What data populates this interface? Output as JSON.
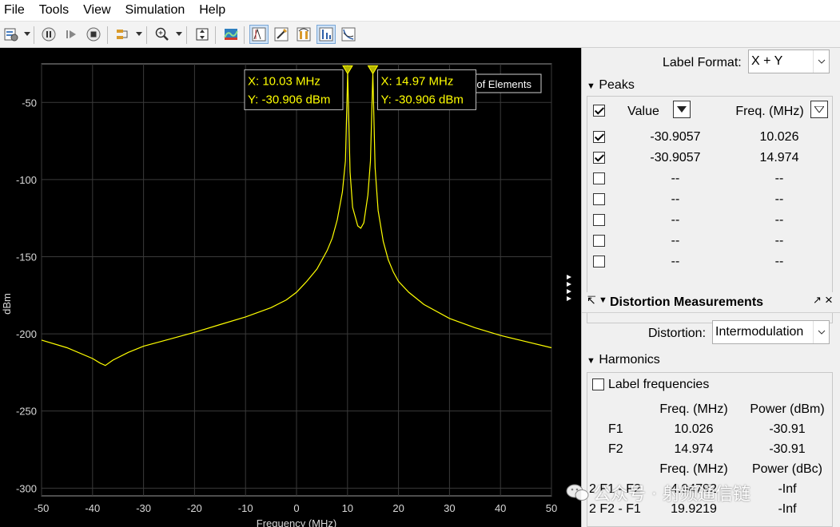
{
  "menu": [
    "File",
    "Tools",
    "View",
    "Simulation",
    "Help"
  ],
  "toolbar": {
    "buttons": [
      "settings-icon",
      "pause-icon",
      "step-forward-icon",
      "stop-icon",
      "highlight-icon",
      "zoom-in-icon",
      "scale-axes-icon",
      "spectrum-settings-icon",
      "data-cursors-icon",
      "peak-finder-icon",
      "channel-measurements-icon",
      "distortion-measurements-icon",
      "ccdf-icon"
    ]
  },
  "colors": {
    "plot_background": "#000000",
    "trace": "#ffff00",
    "axis_text": "#d9d9d9",
    "grid": "#3a3a3a"
  },
  "chart_data": {
    "type": "line",
    "title": "",
    "xlabel": "Frequency (MHz)",
    "ylabel": "dBm",
    "xlim": [
      -50,
      50
    ],
    "ylim": [
      -305,
      -25
    ],
    "xticks": [
      -50,
      -40,
      -30,
      -20,
      -10,
      0,
      10,
      20,
      30,
      40,
      50
    ],
    "yticks": [
      -50,
      -100,
      -150,
      -200,
      -250,
      -300
    ],
    "grid": true,
    "legend": {
      "placement": "top-right",
      "entries": [
        "Sum of Elements"
      ]
    },
    "series": [
      {
        "name": "Sum of Elements",
        "x": [
          -50,
          -45,
          -40,
          -38.5,
          -37.5,
          -36,
          -33,
          -30,
          -25,
          -20,
          -15,
          -10,
          -5,
          -2,
          0,
          2,
          4,
          6,
          7,
          8,
          9,
          9.6,
          10.03,
          10.5,
          11,
          12,
          12.6,
          13.2,
          14,
          14.5,
          14.97,
          15.4,
          16,
          17,
          18,
          19,
          20,
          22,
          25,
          30,
          35,
          40,
          45,
          50
        ],
        "y": [
          -204,
          -209,
          -216,
          -219,
          -220.5,
          -217,
          -212,
          -208,
          -203.5,
          -199,
          -194,
          -189,
          -183,
          -178,
          -173,
          -166,
          -158,
          -146,
          -138,
          -126,
          -108,
          -88,
          -30.906,
          -95,
          -118,
          -130,
          -131.5,
          -128,
          -110,
          -88,
          -30.906,
          -92,
          -120,
          -140,
          -152,
          -160,
          -166,
          -173,
          -181,
          -190,
          -196,
          -201,
          -205,
          -209
        ]
      }
    ],
    "annotations": [
      {
        "x_label": "X: 10.03 MHz",
        "y_label": "Y: -30.906 dBm",
        "x": 10.03,
        "y": -30.906
      },
      {
        "x_label": "X: 14.97 MHz",
        "y_label": "Y: -30.906 dBm",
        "x": 14.97,
        "y": -30.906
      }
    ]
  },
  "right_panel": {
    "label_format_label": "Label Format:",
    "label_format_value": "X + Y",
    "peaks_title": "Peaks",
    "peaks_col_value": "Value",
    "peaks_col_freq": "Freq. (MHz)",
    "peaks_rows": [
      {
        "checked": true,
        "value": "-30.9057",
        "freq": "10.026"
      },
      {
        "checked": true,
        "value": "-30.9057",
        "freq": "14.974"
      },
      {
        "checked": false,
        "value": "--",
        "freq": "--"
      },
      {
        "checked": false,
        "value": "--",
        "freq": "--"
      },
      {
        "checked": false,
        "value": "--",
        "freq": "--"
      },
      {
        "checked": false,
        "value": "--",
        "freq": "--"
      },
      {
        "checked": false,
        "value": "--",
        "freq": "--"
      }
    ],
    "distortion_title": "Distortion Measurements",
    "distortion_label": "Distortion:",
    "distortion_value": "Intermodulation",
    "harmonics_title": "Harmonics",
    "label_frequencies": "Label frequencies",
    "harm_col_freq": "Freq. (MHz)",
    "harm_col_power_dbm": "Power (dBm)",
    "harm_rows": [
      {
        "name": "F1",
        "freq": "10.026",
        "power": "-30.91"
      },
      {
        "name": "F2",
        "freq": "14.974",
        "power": "-30.91"
      }
    ],
    "harm_col_power_dbc": "Power (dBc)",
    "imd_rows": [
      {
        "name": "2 F1 - F2",
        "freq": "4.94792",
        "power": "-Inf"
      },
      {
        "name": "2 F2 - F1",
        "freq": "19.9219",
        "power": "-Inf"
      }
    ]
  },
  "watermark": "公众号 · 射频通信链"
}
